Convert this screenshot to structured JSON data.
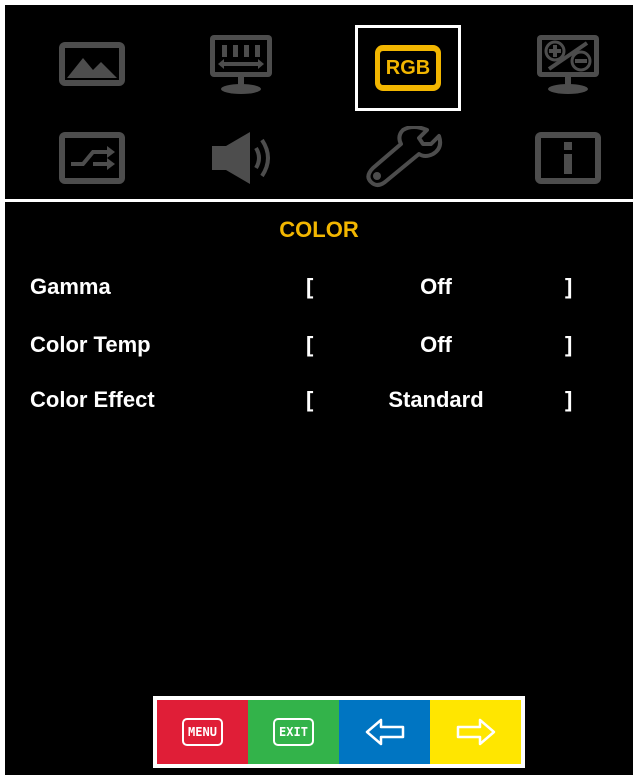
{
  "osd": {
    "selected_tab_label": "RGB",
    "icons": [
      {
        "name": "picture-icon"
      },
      {
        "name": "display-size-icon"
      },
      {
        "name": "rgb-icon"
      },
      {
        "name": "pip-icon"
      },
      {
        "name": "input-source-icon"
      },
      {
        "name": "audio-icon"
      },
      {
        "name": "setup-wrench-icon"
      },
      {
        "name": "info-icon"
      }
    ]
  },
  "section": {
    "title": "COLOR"
  },
  "settings": [
    {
      "label": "Gamma",
      "open_bracket": "[",
      "value": "Off",
      "close_bracket": "]"
    },
    {
      "label": "Color Temp",
      "open_bracket": "[",
      "value": "Off",
      "close_bracket": "]"
    },
    {
      "label": "Color Effect",
      "open_bracket": "[",
      "value": "Standard",
      "close_bracket": "]"
    }
  ],
  "nav_buttons": {
    "menu_label": "MENU",
    "exit_label": "EXIT",
    "left_icon": "arrow-left-icon",
    "right_icon": "arrow-right-icon"
  },
  "colors": {
    "accent": "#f2b600",
    "icon_gray": "#4d4d4d",
    "menu_button": "#e01e37",
    "exit_button": "#33b34a",
    "left_button": "#0075c2",
    "right_button": "#ffe600"
  }
}
